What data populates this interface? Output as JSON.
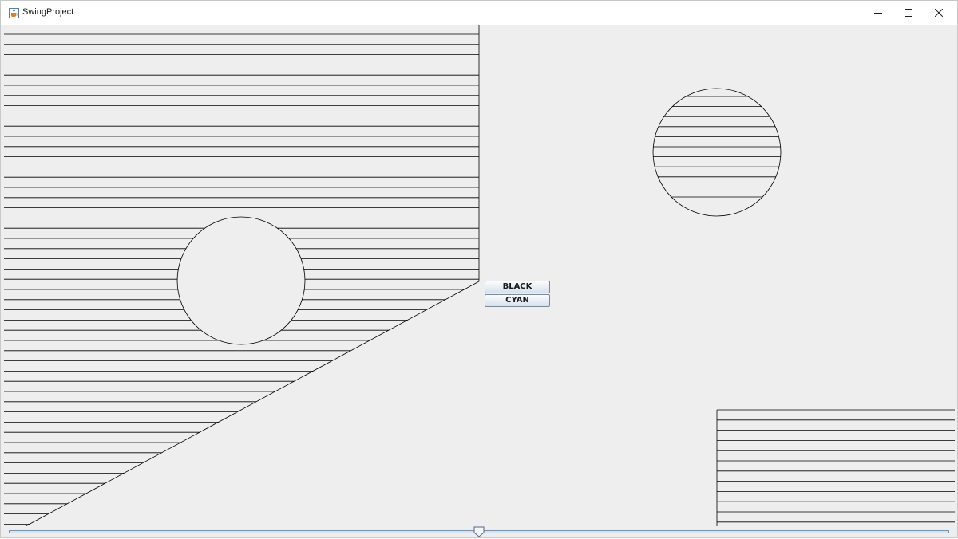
{
  "window": {
    "title": "SwingProject",
    "icon": "java-cup-icon",
    "controls": [
      "minimize-icon",
      "maximize-icon",
      "close-icon"
    ]
  },
  "buttons": {
    "black_label": "BLACK",
    "cyan_label": "CYAN"
  },
  "slider": {
    "value_fraction": 0.5
  },
  "colors": {
    "background": "#eeeeee",
    "stroke": "#000000",
    "button_top": "#fbfcfd",
    "button_bottom": "#d6e1ec",
    "slider_track": "#d9e3ee"
  }
}
